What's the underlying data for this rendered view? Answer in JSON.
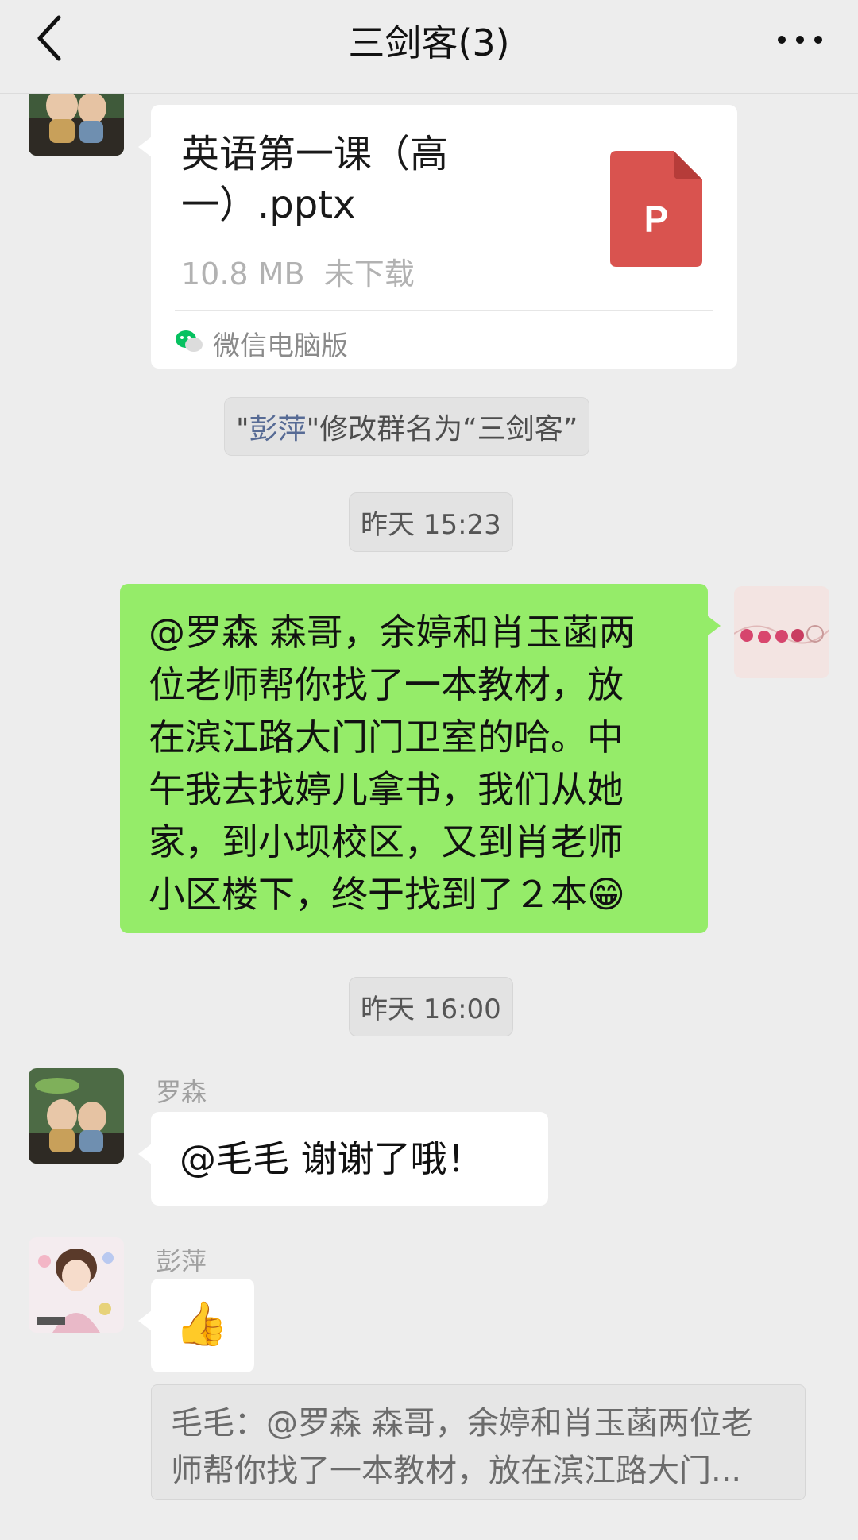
{
  "header": {
    "title": "三剑客(3)"
  },
  "messages": {
    "file": {
      "name": "英语第一课（高一）.pptx",
      "size": "10.8 MB",
      "status": "未下载",
      "icon_letter": "P",
      "source": "微信电脑版"
    },
    "system": {
      "quote_open": "\"",
      "name": "彭萍",
      "quote_close": "\"",
      "text": "修改群名为“三剑客”"
    },
    "time1": "昨天 15:23",
    "sent": {
      "lines": [
        "@罗森  森哥，余婷和肖玉菡两",
        "位老师帮你找了一本教材，放",
        "在滨江路大门门卫室的哈。中",
        "午我去找婷儿拿书，我们从她",
        "家，到小坝校区，又到肖老师",
        "小区楼下，终于找到了２本"
      ],
      "emoji": "😁"
    },
    "time2": "昨天 16:00",
    "reply1": {
      "sender": "罗森",
      "text": "@毛毛  谢谢了哦！"
    },
    "reply2": {
      "sender": "彭萍",
      "emoji": "👍"
    },
    "quote": {
      "lines": [
        "毛毛：@罗森 森哥，余婷和肖玉菡两位老",
        "师帮你找了一本教材，放在滨江路大门..."
      ]
    }
  },
  "colors": {
    "background": "#ededed",
    "sent_bubble": "#95ec69",
    "link": "#576b95",
    "ppt_icon": "#d9534f"
  },
  "icons": {
    "back": "chevron-left-icon",
    "more": "ellipsis-icon",
    "file": "pptx-file-icon",
    "source": "wechat-icon"
  }
}
